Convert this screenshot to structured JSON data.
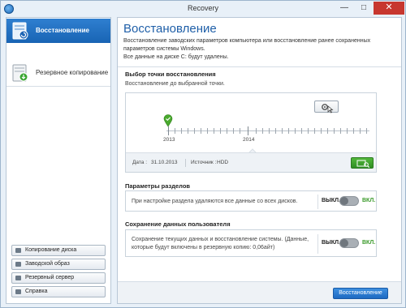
{
  "window": {
    "title": "Recovery"
  },
  "sidebar": {
    "items": [
      {
        "label": "Восстановление",
        "icon": "restore-icon"
      },
      {
        "label": "Резервное копирование",
        "icon": "backup-icon"
      }
    ],
    "tools": [
      {
        "label": "Копирование диска",
        "icon": "disk-icon"
      },
      {
        "label": "Заводской образ",
        "icon": "image-icon"
      },
      {
        "label": "Резервный сервер",
        "icon": "server-icon"
      },
      {
        "label": "Справка",
        "icon": "help-icon"
      }
    ]
  },
  "main": {
    "title": "Восстановление",
    "description": "Восстановление заводских параметров компьютера или восстановление ранее сохраненных параметров системы Windows.",
    "description2": "Все данные на диске C: будут удалены.",
    "restore_point": {
      "section_title": "Выбор точки восстановления",
      "section_sub": "Восстановление до выбранной точки.",
      "year_labels": [
        "2013",
        "2014"
      ],
      "date_label": "Дата :",
      "date_value": "31.10.2013",
      "source_label": "Источник :",
      "source_value": "HDD"
    },
    "partitions": {
      "section_title": "Параметры разделов",
      "text": "При настройке раздела удаляются все данные со всех дисков.",
      "off_label": "ВЫКЛ.",
      "on_label": "ВКЛ.",
      "state": "off"
    },
    "user_data": {
      "section_title": "Сохранение данных пользователя",
      "text": "Сохранение текущих данных и восстановление системы. (Данные, которые будут включены в резервную копию: 0,06айт)",
      "off_label": "ВЫКЛ.",
      "on_label": "ВКЛ.",
      "state": "off"
    },
    "restore_button": "Восстановление"
  },
  "colors": {
    "accent": "#1f5fa8",
    "sidebar_active": "#2373c4",
    "green": "#3a9a2a",
    "close": "#c7372f"
  }
}
